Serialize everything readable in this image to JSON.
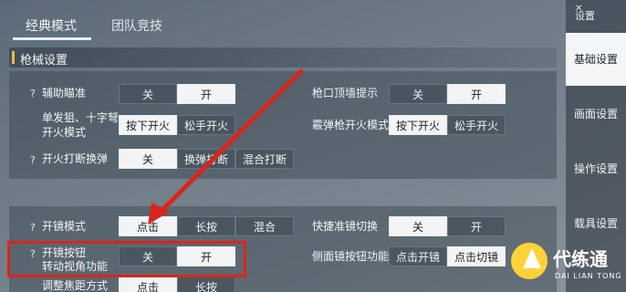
{
  "tabs": [
    "经典模式",
    "团队竞技"
  ],
  "section_title": "枪械设置",
  "rows": {
    "aim_assist": {
      "label": "辅助瞄准",
      "options": [
        "关",
        "开"
      ],
      "selected": 1
    },
    "single_fire": {
      "label_line1": "单发狙、十字弩",
      "label_line2": "开火模式",
      "options": [
        "按下开火",
        "松手开火"
      ],
      "selected": 0
    },
    "fire_swap": {
      "label": "开火打断换弹",
      "options": [
        "关",
        "换弹打断",
        "混合打断"
      ],
      "selected": 0
    },
    "muzzle_hint": {
      "label": "枪口顶墙提示",
      "options": [
        "关",
        "开"
      ],
      "selected": 1
    },
    "shotgun_fire": {
      "label": "霰弹枪开火模式",
      "options": [
        "按下开火",
        "松手开火"
      ],
      "selected": 0
    },
    "scope_mode": {
      "label": "开镜模式",
      "options": [
        "点击",
        "长按",
        "混合"
      ],
      "selected": 0
    },
    "quick_scope_switch": {
      "label": "快捷准镜切换",
      "options": [
        "关",
        "开"
      ],
      "selected": 0
    },
    "scope_button_view": {
      "label_line1": "开镜按钮",
      "label_line2": "转动视角功能",
      "options": [
        "关",
        "开"
      ],
      "selected": 1
    },
    "side_scope_button": {
      "label": "侧面镜按钮功能",
      "options": [
        "点击开镜",
        "点击切镜"
      ],
      "selected": 1
    },
    "focus_mode": {
      "label": "调整焦距方式",
      "options": [
        "点击",
        "长按"
      ],
      "selected": 0
    }
  },
  "sidebar": {
    "title": "设置",
    "items": [
      "基础设置",
      "画面设置",
      "操作设置",
      "载具设置"
    ],
    "active": 0
  },
  "watermark": {
    "name": "代练通",
    "sub": "DAI LIAN TONG"
  },
  "colors": {
    "annotation_red": "#d9261c",
    "selected_bg": "#f2f4f5",
    "watermark_yellow": "#ffd23a"
  }
}
